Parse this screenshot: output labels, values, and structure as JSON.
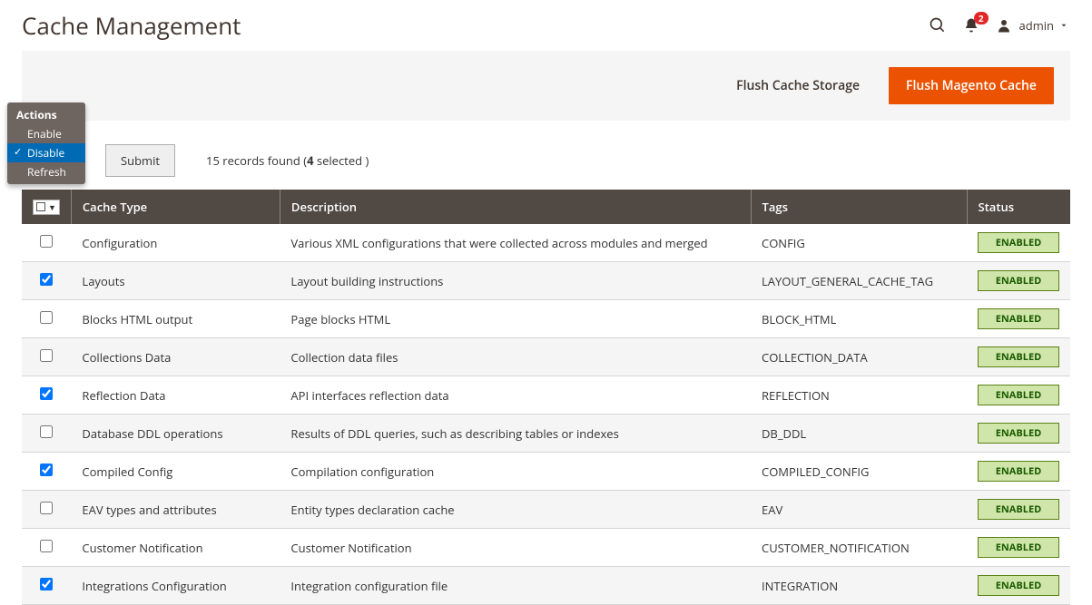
{
  "header": {
    "title": "Cache Management",
    "notifications_count": "2",
    "admin_label": "admin"
  },
  "topActions": {
    "flush_storage": "Flush Cache Storage",
    "flush_magento": "Flush Magento Cache"
  },
  "actionsMenu": {
    "header": "Actions",
    "items": [
      "Enable",
      "Disable",
      "Refresh"
    ],
    "selected": "Disable"
  },
  "controls": {
    "submit": "Submit",
    "records_prefix": "15 records found (",
    "records_selected": "4",
    "records_suffix": " selected )"
  },
  "table": {
    "columns": {
      "type": "Cache Type",
      "desc": "Description",
      "tags": "Tags",
      "status": "Status"
    },
    "rows": [
      {
        "checked": false,
        "type": "Configuration",
        "desc": "Various XML configurations that were collected across modules and merged",
        "tags": "CONFIG",
        "status": "ENABLED"
      },
      {
        "checked": true,
        "type": "Layouts",
        "desc": "Layout building instructions",
        "tags": "LAYOUT_GENERAL_CACHE_TAG",
        "status": "ENABLED"
      },
      {
        "checked": false,
        "type": "Blocks HTML output",
        "desc": "Page blocks HTML",
        "tags": "BLOCK_HTML",
        "status": "ENABLED"
      },
      {
        "checked": false,
        "type": "Collections Data",
        "desc": "Collection data files",
        "tags": "COLLECTION_DATA",
        "status": "ENABLED"
      },
      {
        "checked": true,
        "type": "Reflection Data",
        "desc": "API interfaces reflection data",
        "tags": "REFLECTION",
        "status": "ENABLED"
      },
      {
        "checked": false,
        "type": "Database DDL operations",
        "desc": "Results of DDL queries, such as describing tables or indexes",
        "tags": "DB_DDL",
        "status": "ENABLED"
      },
      {
        "checked": true,
        "type": "Compiled Config",
        "desc": "Compilation configuration",
        "tags": "COMPILED_CONFIG",
        "status": "ENABLED"
      },
      {
        "checked": false,
        "type": "EAV types and attributes",
        "desc": "Entity types declaration cache",
        "tags": "EAV",
        "status": "ENABLED"
      },
      {
        "checked": false,
        "type": "Customer Notification",
        "desc": "Customer Notification",
        "tags": "CUSTOMER_NOTIFICATION",
        "status": "ENABLED"
      },
      {
        "checked": true,
        "type": "Integrations Configuration",
        "desc": "Integration configuration file",
        "tags": "INTEGRATION",
        "status": "ENABLED"
      }
    ]
  }
}
